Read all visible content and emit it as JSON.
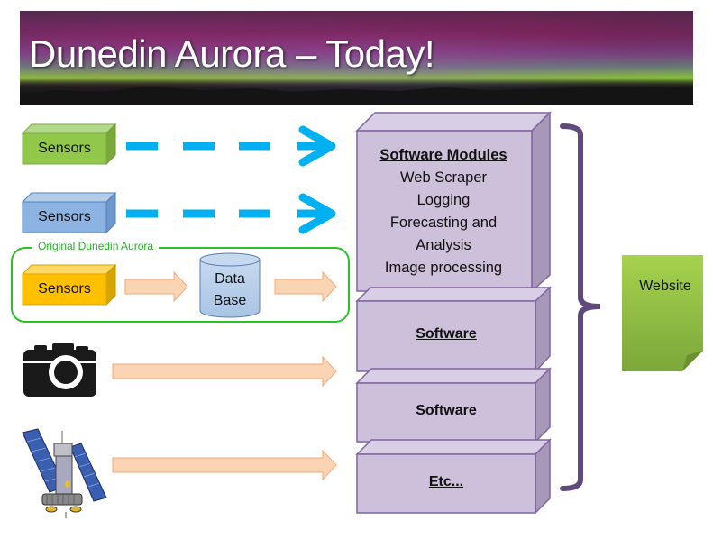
{
  "banner": {
    "title": "Dunedin Aurora – Today!"
  },
  "sources": [
    {
      "type": "sensor",
      "label": "Sensors",
      "color": "#92c84a",
      "arrow": "dashed"
    },
    {
      "type": "sensor",
      "label": "Sensors",
      "color": "#8db3e2",
      "arrow": "dashed"
    },
    {
      "type": "sensor",
      "label": "Sensors",
      "color": "#ffc000",
      "arrow": "block"
    },
    {
      "type": "camera",
      "icon": "camera-icon",
      "arrow": "block"
    },
    {
      "type": "satellite",
      "icon": "satellite-icon",
      "arrow": "block"
    }
  ],
  "original_group": {
    "label": "Original Dunedin Aurora",
    "color": "#2cc02c"
  },
  "database": {
    "line1": "Data",
    "line2": "Base"
  },
  "software_stack": {
    "modules": {
      "heading": "Software Modules",
      "items": [
        "Web Scraper",
        "Logging",
        "Forecasting and",
        "Analysis",
        "Image processing"
      ]
    },
    "blocks": [
      "Software",
      "Software",
      "Etc..."
    ]
  },
  "output": {
    "label": "Website",
    "color": "#8dc63f"
  },
  "colors": {
    "dashed_arrow": "#00b0f0",
    "block_arrow_fill": "#fbd4b4",
    "block_arrow_stroke": "#f0a878",
    "stack_fill": "#ccc0da",
    "stack_stroke": "#8064a2",
    "brace": "#604a7b"
  }
}
